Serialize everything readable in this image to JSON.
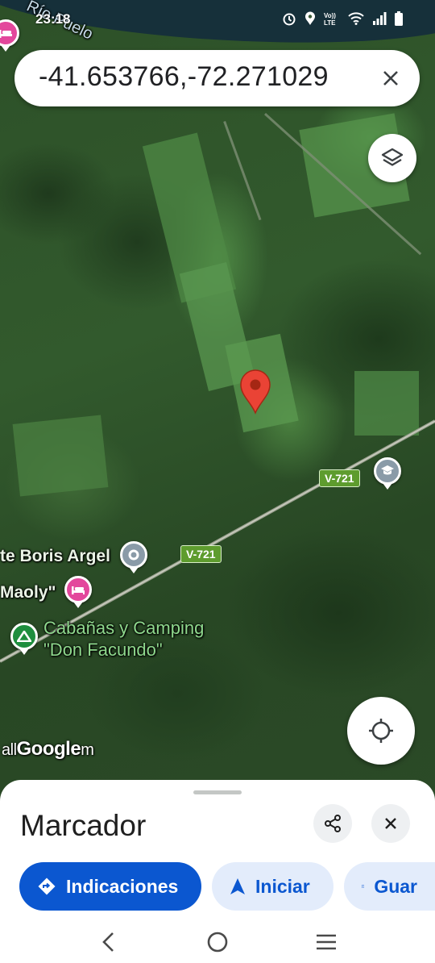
{
  "status_bar": {
    "time": "23:18",
    "icons": [
      "alarm-icon",
      "location-icon",
      "volte-icon",
      "wifi-icon",
      "signal-icon",
      "battery-icon"
    ],
    "volte_label": "Vo))\nLTE"
  },
  "search": {
    "query": "-41.653766,-72.271029",
    "clear_icon": "close-icon"
  },
  "map": {
    "type": "satellite",
    "labels": {
      "river": "Río Puelo",
      "boris": "te Boris Argel",
      "maoly": "Maoly\"",
      "camping_line1": "Cabañas y Camping",
      "camping_line2": "\"Don Facundo\""
    },
    "road_shields": [
      "V-721",
      "V-721"
    ],
    "road_shield_color": "#5e9c2e",
    "attribution_prefix": "all",
    "attribution_logo": "Google",
    "attribution_suffix": "m",
    "marker_color": "#ea4335",
    "poi_colors": {
      "lodging": "#e3479c",
      "camping": "#1e8e3e",
      "place": "#8a9ba8",
      "school": "#8a9ba8"
    }
  },
  "controls": {
    "layers_icon": "layers-icon",
    "my_location_icon": "my-location-icon"
  },
  "sheet": {
    "title": "Marcador",
    "share_icon": "share-icon",
    "close_icon": "close-icon",
    "actions": [
      {
        "label": "Indicaciones",
        "icon": "directions-icon",
        "style": "primary"
      },
      {
        "label": "Iniciar",
        "icon": "navigation-arrow-icon",
        "style": "secondary"
      },
      {
        "label": "Guar",
        "icon": "bookmark-icon",
        "style": "secondary"
      }
    ],
    "accent_color": "#0b57d0"
  },
  "navbar": {
    "icons": [
      "back-icon",
      "home-icon",
      "recents-icon"
    ]
  }
}
